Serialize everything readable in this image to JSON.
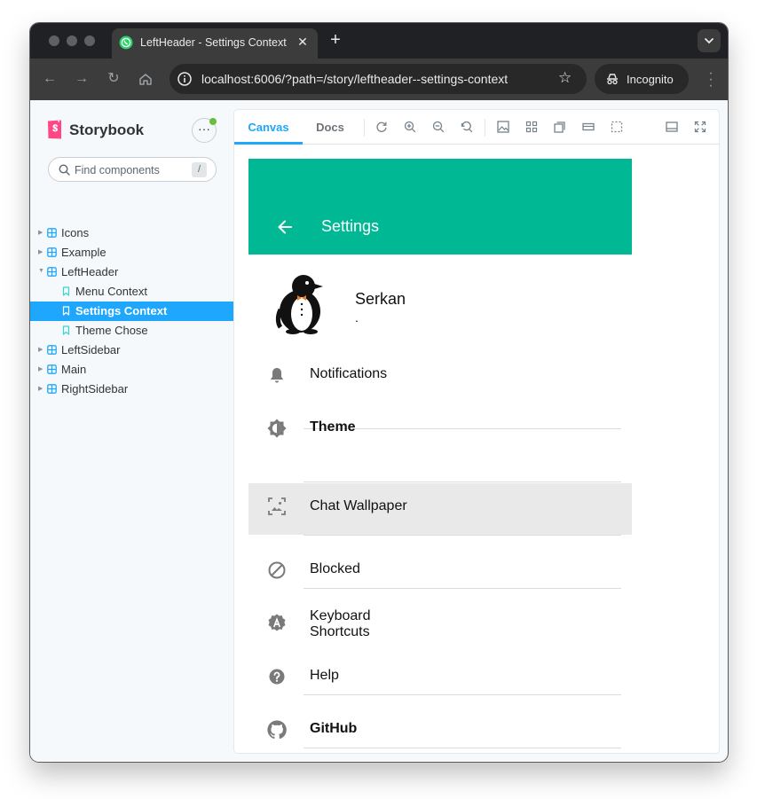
{
  "browser": {
    "tab_title": "LeftHeader - Settings Context",
    "url": "localhost:6006/?path=/story/leftheader--settings-context",
    "incognito_label": "Incognito"
  },
  "storybook": {
    "brand": "Storybook",
    "search_placeholder": "Find components",
    "search_shortcut": "/",
    "tree": [
      {
        "label": "Icons",
        "kind": "component",
        "expanded": false
      },
      {
        "label": "Example",
        "kind": "component",
        "expanded": false
      },
      {
        "label": "LeftHeader",
        "kind": "component",
        "expanded": true
      },
      {
        "label": "Menu Context",
        "kind": "story",
        "selected": false
      },
      {
        "label": "Settings Context",
        "kind": "story",
        "selected": true
      },
      {
        "label": "Theme Chose",
        "kind": "story",
        "selected": false
      },
      {
        "label": "LeftSidebar",
        "kind": "component",
        "expanded": false
      },
      {
        "label": "Main",
        "kind": "component",
        "expanded": false
      },
      {
        "label": "RightSidebar",
        "kind": "component",
        "expanded": false
      }
    ],
    "panel_tabs": {
      "canvas": "Canvas",
      "docs": "Docs"
    }
  },
  "settings_panel": {
    "header_title": "Settings",
    "profile": {
      "name": "Serkan",
      "status": "."
    },
    "items": [
      {
        "label": "Notifications",
        "icon": "bell-icon",
        "bold": false
      },
      {
        "label": "Theme",
        "icon": "theme-icon",
        "bold": true
      },
      {
        "label": "Chat Wallpaper",
        "icon": "wallpaper-icon",
        "bold": false,
        "hover": true
      },
      {
        "label": "Blocked",
        "icon": "block-icon",
        "bold": false
      },
      {
        "label": "Keyboard",
        "label2": "Shortcuts",
        "icon": "keyboard-icon",
        "bold": false
      },
      {
        "label": "Help",
        "icon": "help-icon",
        "bold": false
      },
      {
        "label": "GitHub",
        "icon": "github-icon",
        "bold": true
      }
    ]
  },
  "colors": {
    "accent": "#1ea7fd",
    "header": "#00b894",
    "hover": "#e9e9e9"
  }
}
